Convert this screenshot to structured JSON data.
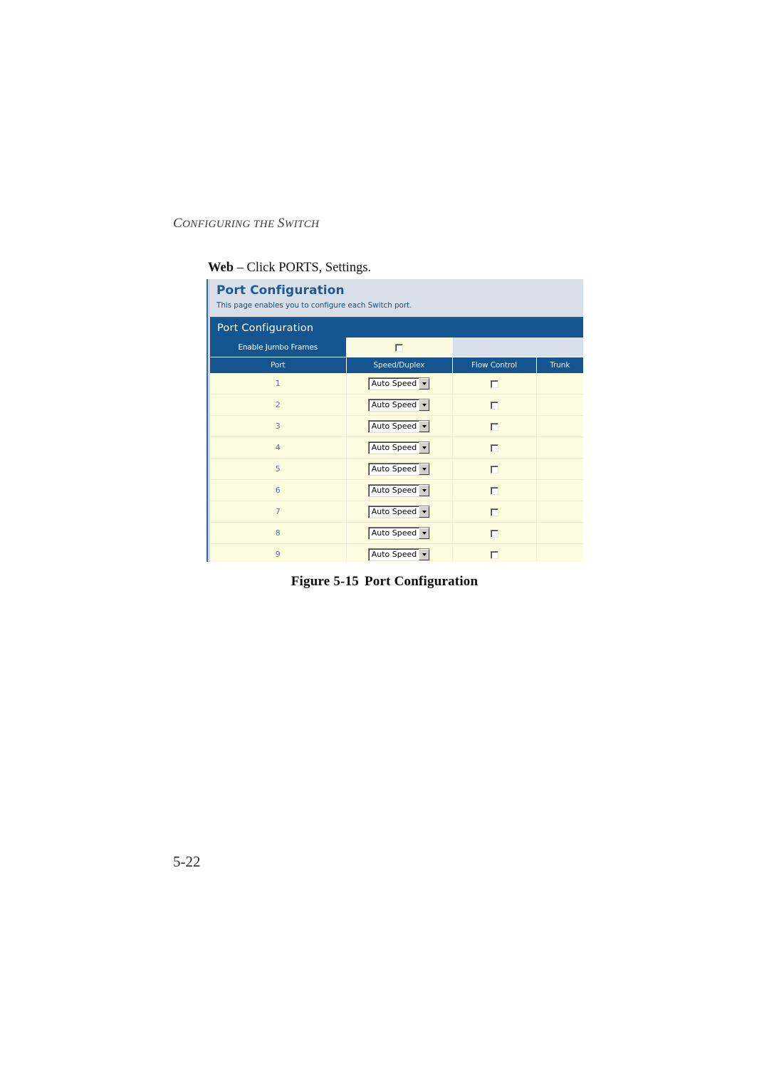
{
  "document": {
    "running_head": "Configuring the Switch",
    "running_head_parts": {
      "word1_first": "C",
      "word1_rest": "ONFIGURING",
      "word2": "THE",
      "word3_first": "S",
      "word3_rest": "WITCH"
    },
    "lead_in_bold": "Web",
    "lead_in_text": " – Click PORTS, Settings.",
    "figure_caption_number": "Figure 5-15",
    "figure_caption_title": "Port Configuration",
    "page_number": "5-22"
  },
  "screenshot": {
    "page_header": {
      "title": "Port Configuration",
      "description": "This page enables you to configure each Switch port."
    },
    "table": {
      "title": "Port Configuration",
      "jumbo_row": {
        "label": "Enable Jumbo Frames",
        "checkbox_checked": false
      },
      "columns": [
        "Port",
        "Speed/Duplex",
        "Flow Control",
        "Trunk"
      ],
      "rows": [
        {
          "port": "1",
          "speed_duplex": "Auto Speed",
          "flow_control_checked": false,
          "trunk": ""
        },
        {
          "port": "2",
          "speed_duplex": "Auto Speed",
          "flow_control_checked": false,
          "trunk": ""
        },
        {
          "port": "3",
          "speed_duplex": "Auto Speed",
          "flow_control_checked": false,
          "trunk": ""
        },
        {
          "port": "4",
          "speed_duplex": "Auto Speed",
          "flow_control_checked": false,
          "trunk": ""
        },
        {
          "port": "5",
          "speed_duplex": "Auto Speed",
          "flow_control_checked": false,
          "trunk": ""
        },
        {
          "port": "6",
          "speed_duplex": "Auto Speed",
          "flow_control_checked": false,
          "trunk": ""
        },
        {
          "port": "7",
          "speed_duplex": "Auto Speed",
          "flow_control_checked": false,
          "trunk": ""
        },
        {
          "port": "8",
          "speed_duplex": "Auto Speed",
          "flow_control_checked": false,
          "trunk": ""
        },
        {
          "port": "9",
          "speed_duplex": "Auto Speed",
          "flow_control_checked": false,
          "trunk": ""
        }
      ]
    },
    "colors": {
      "header_band": "#d9dfe8",
      "table_blue": "#14558f",
      "row_cream": "#fdfcdf",
      "title_blue": "#1c5a93",
      "port_number": "#4e7a98"
    }
  }
}
